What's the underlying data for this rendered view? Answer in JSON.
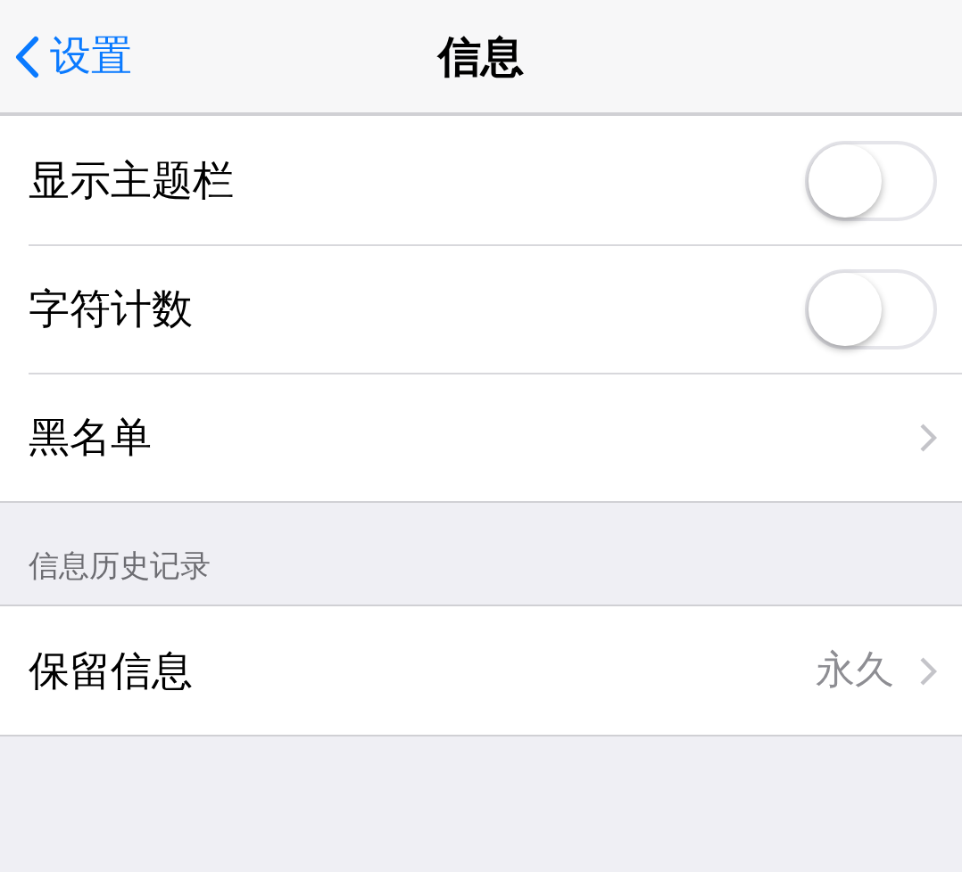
{
  "nav": {
    "back": "设置",
    "title": "信息"
  },
  "groups": [
    {
      "rows": [
        {
          "kind": "toggle",
          "label": "显示主题栏",
          "on": false
        },
        {
          "kind": "toggle",
          "label": "字符计数",
          "on": false
        },
        {
          "kind": "link",
          "label": "黑名单"
        }
      ]
    },
    {
      "header": "信息历史记录",
      "rows": [
        {
          "kind": "link",
          "label": "保留信息",
          "value": "永久"
        }
      ]
    }
  ]
}
